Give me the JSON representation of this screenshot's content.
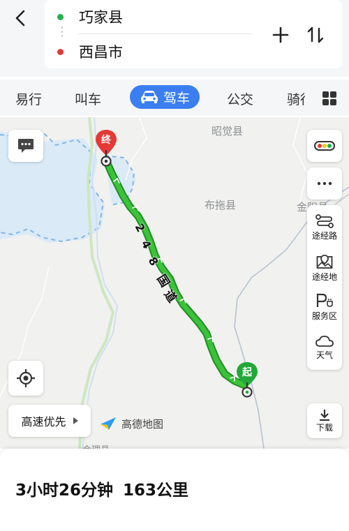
{
  "route": {
    "origin": "巧家县",
    "destination": "西昌市",
    "origin_color": "#22b14c",
    "destination_color": "#e53935"
  },
  "tabs": [
    {
      "label": "易行",
      "active": false
    },
    {
      "label": "叫车",
      "active": false
    },
    {
      "label": "驾车",
      "active": true
    },
    {
      "label": "公交",
      "active": false
    },
    {
      "label": "骑行",
      "active": false
    }
  ],
  "accent_color": "#3a7ef2",
  "route_color": "#27b32d",
  "map": {
    "labels": [
      "昭觉县",
      "布拖县",
      "金阳县",
      "会理县"
    ],
    "road_label": "248国道",
    "start_pin": "起",
    "end_pin": "终",
    "brand": "高德地图"
  },
  "controls": {
    "route_preference": "高速优先",
    "tools": [
      {
        "label": "途经路",
        "icon": "route-path-icon"
      },
      {
        "label": "途经地",
        "icon": "map-pin-icon"
      },
      {
        "label": "服务区",
        "icon": "service-area-icon"
      },
      {
        "label": "天气",
        "icon": "cloud-icon"
      }
    ],
    "download": "下载"
  },
  "summary": {
    "duration": "3小时26分钟",
    "distance": "163公里"
  }
}
